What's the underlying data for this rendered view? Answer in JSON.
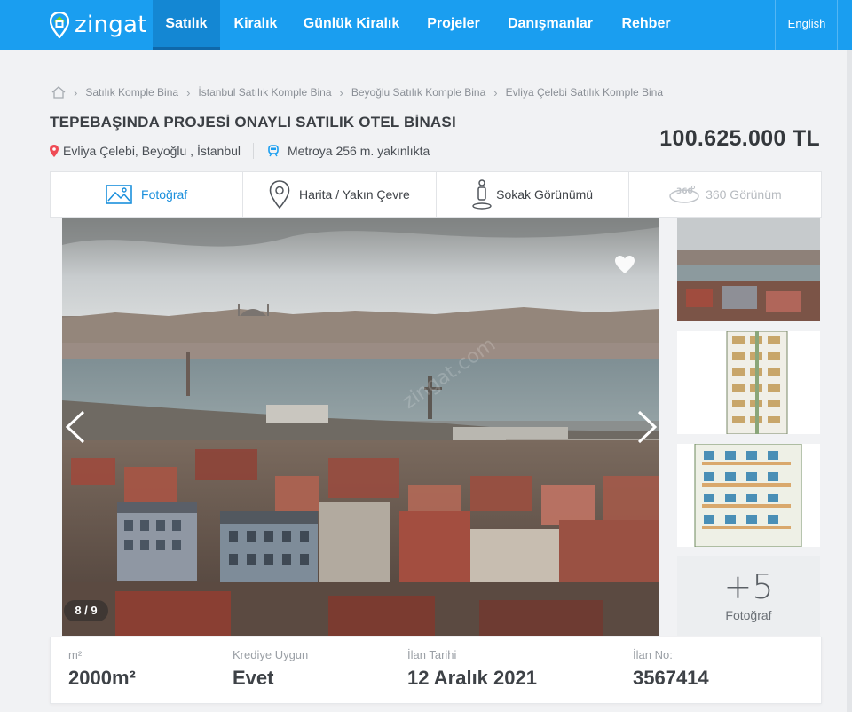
{
  "nav": {
    "logo_text": "zingat",
    "items": [
      {
        "label": "Satılık"
      },
      {
        "label": "Kiralık"
      },
      {
        "label": "Günlük Kiralık"
      },
      {
        "label": "Projeler"
      },
      {
        "label": "Danışmanlar"
      },
      {
        "label": "Rehber"
      }
    ],
    "language": "English",
    "brand_color": "#1a9ef0"
  },
  "breadcrumb": [
    "Satılık Komple Bina",
    "İstanbul Satılık Komple Bina",
    "Beyoğlu Satılık Komple Bina",
    "Evliya Çelebi Satılık Komple Bina"
  ],
  "listing": {
    "title": "TEPEBAŞINDA PROJESİ ONAYLI SATILIK OTEL BİNASI",
    "location": "Evliya Çelebi, Beyoğlu , İstanbul",
    "transit": "Metroya 256 m. yakınlıkta",
    "price": "100.625.000 TL"
  },
  "tabs": [
    {
      "label": "Fotoğraf",
      "icon": "photo-icon",
      "state": "active"
    },
    {
      "label": "Harita / Yakın Çevre",
      "icon": "map-pin-icon",
      "state": "normal"
    },
    {
      "label": "Sokak Görünümü",
      "icon": "street-view-icon",
      "state": "normal"
    },
    {
      "label": "360 Görünüm",
      "icon": "360-view-icon",
      "state": "disabled"
    }
  ],
  "gallery": {
    "counter": "8 / 9",
    "more_count": "+5",
    "more_label": "Fotoğraf",
    "watermark": "zingat.com"
  },
  "info": [
    {
      "label": "m²",
      "value": "2000m²"
    },
    {
      "label": "Krediye Uygun",
      "value": "Evet"
    },
    {
      "label": "İlan Tarihi",
      "value": "12 Aralık 2021"
    },
    {
      "label": "İlan No:",
      "value": "3567414"
    }
  ]
}
